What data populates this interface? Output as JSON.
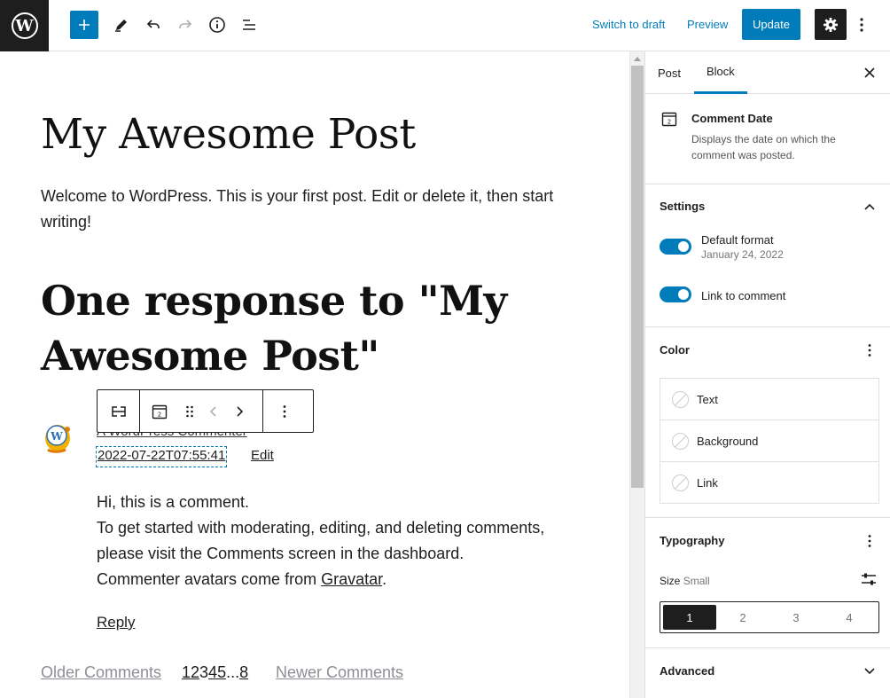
{
  "toolbar": {
    "switch_to_draft": "Switch to draft",
    "preview": "Preview",
    "update": "Update"
  },
  "editor": {
    "post_title": "My Awesome Post",
    "post_body": "Welcome to WordPress. This is your first post. Edit or delete it, then start writing!",
    "comments_title": "One response to \"My Awesome Post\"",
    "comment": {
      "author": "A WordPress Commenter",
      "date": "2022-07-22T07:55:41",
      "edit_label": "Edit",
      "lines": [
        "Hi, this is a comment.",
        "To get started with moderating, editing, and deleting comments, please visit the Comments screen in the dashboard.",
        "Commenter avatars come from"
      ],
      "gravatar_link": "Gravatar",
      "reply_label": "Reply"
    },
    "pagination": {
      "older": "Older Comments",
      "pages": [
        "1",
        "2",
        "3",
        "4",
        "5",
        "...",
        "8"
      ],
      "newer": "Newer Comments"
    },
    "block_toolbar_icon_number": "2"
  },
  "sidebar": {
    "tabs": [
      "Post",
      "Block"
    ],
    "active_tab": "Block",
    "block_card": {
      "title": "Comment Date",
      "description": "Displays the date on which the comment was posted.",
      "icon_number": "2"
    },
    "settings": {
      "title": "Settings",
      "default_format_label": "Default format",
      "default_format_value": "January 24, 2022",
      "default_format_on": true,
      "link_to_comment_label": "Link to comment",
      "link_to_comment_on": true
    },
    "color": {
      "title": "Color",
      "items": [
        "Text",
        "Background",
        "Link"
      ]
    },
    "typography": {
      "title": "Typography",
      "size_label": "Size",
      "size_value": "Small",
      "sizes": [
        "1",
        "2",
        "3",
        "4"
      ],
      "active_size": "1"
    },
    "advanced": {
      "title": "Advanced"
    }
  },
  "colors": {
    "accent": "#007cba",
    "dark": "#1e1e1e"
  }
}
